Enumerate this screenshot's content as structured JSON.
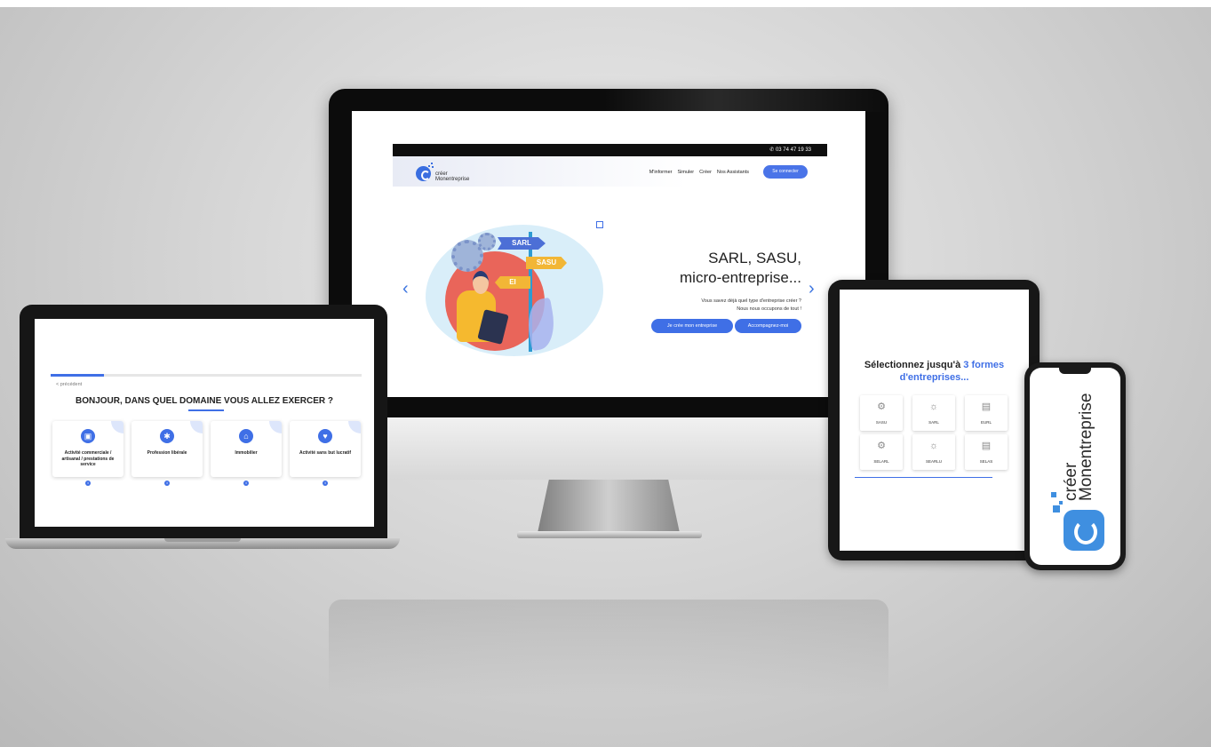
{
  "desktop_site": {
    "phone": "03 74 47 19 33",
    "logo": {
      "line1": "créer",
      "line2": "Monentreprise"
    },
    "nav": [
      "M'informer",
      "Simuler",
      "Créer",
      "Nos Assistants"
    ],
    "login_button": "Se connecter",
    "hero": {
      "signs": [
        "SARL",
        "SASU",
        "EI"
      ],
      "title_line1": "SARL, SASU,",
      "title_line2": "micro-entreprise...",
      "subtitle_line1": "Vous savez déjà quel type d'entreprise créer ?",
      "subtitle_line2": "Nous nous occupons de tout !",
      "primary_button": "Je crée mon entreprise",
      "secondary_button": "Accompagnez-moi",
      "prev_arrow": "‹",
      "next_arrow": "›"
    }
  },
  "laptop_site": {
    "progress_fraction": 0.17,
    "back_link": "< précédent",
    "question": "BONJOUR, DANS QUEL DOMAINE VOUS ALLEZ EXERCER ?",
    "options": [
      {
        "label": "Activité commerciale / artisanal / prestations de service",
        "icon": "shop-icon"
      },
      {
        "label": "Profession libérale",
        "icon": "runner-icon"
      },
      {
        "label": "Immobilier",
        "icon": "home-icon"
      },
      {
        "label": "Activité sans but lucratif",
        "icon": "hand-heart-icon"
      }
    ],
    "info_glyph": "i"
  },
  "tablet_site": {
    "title_part1": "Sélectionnez jusqu'à",
    "title_part2": "3 formes d'entreprises...",
    "forms": [
      "SASU",
      "SARL",
      "EURL",
      "SELARL",
      "SEARLU",
      "SELAS"
    ]
  },
  "phone_site": {
    "logo_line1": "créer",
    "logo_line2": "Monentreprise"
  },
  "colors": {
    "accent": "#3f6fe6",
    "hero_circle": "#e9655a",
    "sign_blue": "#4c6fd6",
    "sign_yellow": "#f2b636"
  }
}
